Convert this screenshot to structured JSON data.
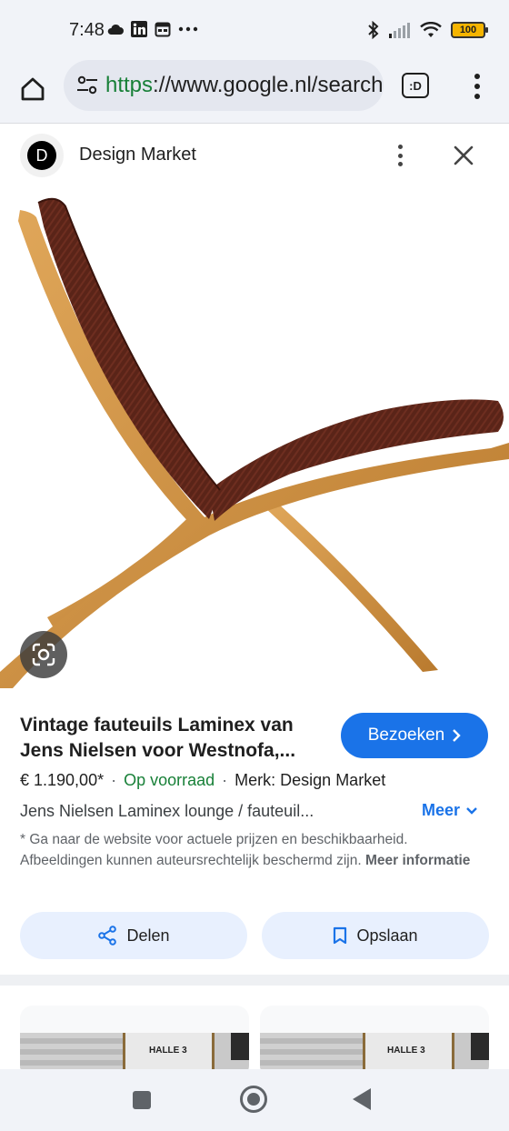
{
  "status_bar": {
    "time": "7:48",
    "battery": "100",
    "icons": [
      "cloud-icon",
      "linkedin-icon",
      "calendar-icon",
      "more-horiz-icon",
      "bluetooth-icon",
      "signal-icon",
      "wifi-icon",
      "battery-icon"
    ]
  },
  "browser": {
    "url_scheme": "https",
    "url_rest": "://www.google.nl/search",
    "tabs_label": ":D"
  },
  "panel": {
    "brand_initial": "D",
    "brand_name": "Design Market"
  },
  "product": {
    "title": "Vintage fauteuils Laminex van Jens Nielsen voor Westnofa,...",
    "visit_label": "Bezoeken",
    "price": "€ 1.190,00*",
    "stock": "Op voorraad",
    "brand": "Merk: Design Market",
    "description": "Jens Nielsen Laminex lounge / fauteuil...",
    "more_label": "Meer",
    "disclaimer": "* Ga naar de website voor actuele prijzen en beschikbaarheid. Afbeeldingen kunnen auteursrechtelijk beschermd zijn.",
    "more_info_label": "Meer informatie",
    "share_label": "Delen",
    "save_label": "Opslaan"
  },
  "related": [
    {
      "sign": "HALLE 3"
    },
    {
      "sign": "HALLE 3"
    }
  ],
  "colors": {
    "accent": "#1a73e8",
    "stock_green": "#188038",
    "chip_bg": "#e8f0fe",
    "chrome_bg": "#f1f3f8"
  }
}
